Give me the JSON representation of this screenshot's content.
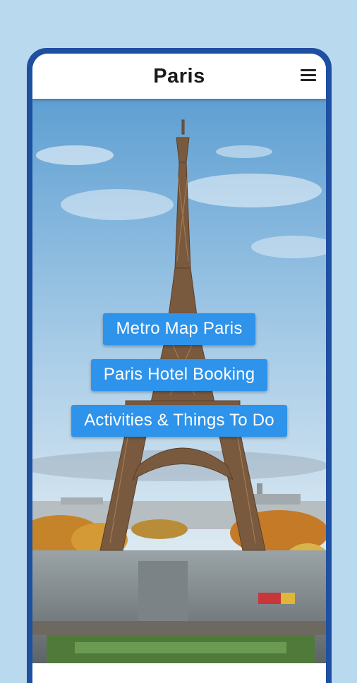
{
  "app": {
    "title": "Paris"
  },
  "header": {
    "menu_icon": "hamburger-menu-icon"
  },
  "hero": {
    "subject": "eiffel-tower-photo"
  },
  "actions": [
    {
      "label": "Metro Map Paris"
    },
    {
      "label": "Paris Hotel Booking"
    },
    {
      "label": "Activities & Things To Do"
    }
  ],
  "colors": {
    "background": "#b9d9ef",
    "frame": "#1e4fa0",
    "button": "#2e93ea",
    "button_text": "#ffffff"
  }
}
